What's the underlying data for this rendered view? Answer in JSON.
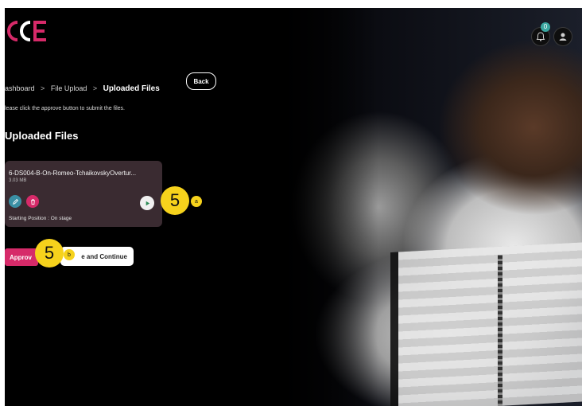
{
  "brand": {
    "logo_text": "CCE",
    "accent": "#d62a69"
  },
  "header": {
    "notifications_count": "0",
    "icons": [
      "bell-icon",
      "user-icon"
    ]
  },
  "breadcrumb": {
    "items": [
      "ashboard",
      "File Upload",
      "Uploaded Files"
    ],
    "separator": ">"
  },
  "back_button": {
    "label": "Back"
  },
  "instruction": "lease click the approve button to submit the files.",
  "section_title": "Uploaded Files",
  "file": {
    "name": "6-DS004-B-On-Romeo-TchaikovskyOvertur...",
    "size": "3.03 MB",
    "starting_position": "Starting Position : On stage"
  },
  "callouts": [
    {
      "number": "5",
      "tag": "a"
    },
    {
      "number": "5",
      "tag": "b"
    }
  ],
  "buttons": {
    "approve_label": "Approv",
    "save_label": "e and Continue"
  },
  "colors": {
    "card_bg": "#3a2b31",
    "edit_icon_bg": "#3a8fa4",
    "delete_icon_bg": "#d62a69",
    "callout_bg": "#f6d21c"
  }
}
